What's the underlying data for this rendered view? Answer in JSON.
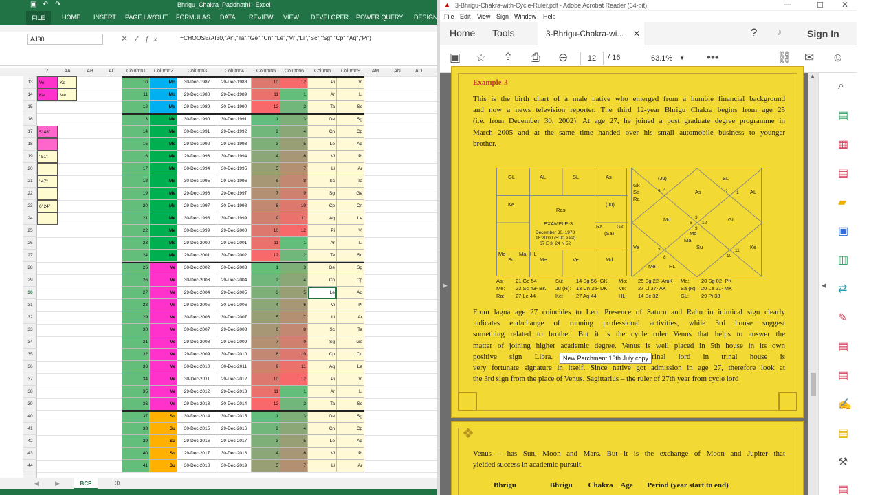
{
  "excel": {
    "title": "Bhrigu_Chakra_Paddhathi - Excel",
    "tabs": [
      "FILE",
      "HOME",
      "INSERT",
      "PAGE LAYOUT",
      "FORMULAS",
      "DATA",
      "REVIEW",
      "VIEW",
      "DEVELOPER",
      "POWER QUERY",
      "DESIGN"
    ],
    "name_box": "AJ30",
    "formula": "=CHOOSE(AI30,\"Ar\",\"Ta\",\"Ge\",\"Cn\",\"Le\",\"Vi\",\"Li\",\"Sc\",\"Sg\",\"Cp\",\"Aq\",\"Pi\")",
    "column_headers": [
      "Z",
      "AA",
      "AB",
      "AC",
      "Column1",
      "Column2",
      "Column3",
      "Column4",
      "Column5",
      "Column6",
      "Column",
      "Column9",
      "AM",
      "AN",
      "AO"
    ],
    "row_numbers": [
      "13",
      "14",
      "15",
      "16",
      "17",
      "18",
      "19",
      "20",
      "21",
      "22",
      "23",
      "24",
      "25",
      "26",
      "27",
      "28",
      "29",
      "30",
      "31",
      "32",
      "33",
      "34",
      "35",
      "36",
      "37",
      "38",
      "39",
      "40",
      "41",
      "42",
      "43",
      "44"
    ],
    "left_cells": [
      {
        "row": 0,
        "col": "z",
        "text": "Ve"
      },
      {
        "row": 0,
        "col": "aa",
        "text": "Ke"
      },
      {
        "row": 1,
        "col": "z",
        "text": "Ke"
      },
      {
        "row": 1,
        "col": "aa",
        "text": "Me"
      },
      {
        "row": 4,
        "col": "z",
        "text": "5' 48\""
      },
      {
        "row": 6,
        "col": "z",
        "text": "' 51\""
      },
      {
        "row": 8,
        "col": "z",
        "text": "' 47\""
      },
      {
        "row": 10,
        "col": "z",
        "text": "6' 24\""
      }
    ],
    "table_rows": [
      [
        "10",
        "Mo",
        "30-Dec-1987",
        "29-Dec-1988",
        "10",
        "12",
        "Pi",
        "Vi"
      ],
      [
        "11",
        "Mo",
        "29-Dec-1988",
        "29-Dec-1989",
        "11",
        "1",
        "Ar",
        "Li"
      ],
      [
        "12",
        "Mo",
        "29-Dec-1989",
        "30-Dec-1990",
        "12",
        "2",
        "Ta",
        "Sc"
      ],
      [
        "13",
        "Me",
        "30-Dec-1990",
        "30-Dec-1991",
        "1",
        "3",
        "Ge",
        "Sg"
      ],
      [
        "14",
        "Me",
        "30-Dec-1991",
        "29-Dec-1992",
        "2",
        "4",
        "Cn",
        "Cp"
      ],
      [
        "15",
        "Me",
        "29-Dec-1992",
        "29-Dec-1993",
        "3",
        "5",
        "Le",
        "Aq"
      ],
      [
        "16",
        "Me",
        "29-Dec-1993",
        "30-Dec-1994",
        "4",
        "6",
        "Vi",
        "Pi"
      ],
      [
        "17",
        "Me",
        "30-Dec-1994",
        "30-Dec-1995",
        "5",
        "7",
        "Li",
        "Ar"
      ],
      [
        "18",
        "Me",
        "30-Dec-1995",
        "29-Dec-1996",
        "6",
        "8",
        "Sc",
        "Ta"
      ],
      [
        "19",
        "Me",
        "29-Dec-1996",
        "29-Dec-1997",
        "7",
        "9",
        "Sg",
        "Ge"
      ],
      [
        "20",
        "Me",
        "29-Dec-1997",
        "30-Dec-1998",
        "8",
        "10",
        "Cp",
        "Cn"
      ],
      [
        "21",
        "Me",
        "30-Dec-1998",
        "30-Dec-1999",
        "9",
        "11",
        "Aq",
        "Le"
      ],
      [
        "22",
        "Me",
        "30-Dec-1999",
        "29-Dec-2000",
        "10",
        "12",
        "Pi",
        "Vi"
      ],
      [
        "23",
        "Me",
        "29-Dec-2000",
        "29-Dec-2001",
        "11",
        "1",
        "Ar",
        "Li"
      ],
      [
        "24",
        "Me",
        "29-Dec-2001",
        "30-Dec-2002",
        "12",
        "2",
        "Ta",
        "Sc"
      ],
      [
        "25",
        "Ve",
        "30-Dec-2002",
        "30-Dec-2003",
        "1",
        "3",
        "Ge",
        "Sg"
      ],
      [
        "26",
        "Ve",
        "30-Dec-2003",
        "29-Dec-2004",
        "2",
        "4",
        "Cn",
        "Cp"
      ],
      [
        "27",
        "Ve",
        "29-Dec-2004",
        "29-Dec-2005",
        "3",
        "5",
        "Le",
        "Aq"
      ],
      [
        "28",
        "Ve",
        "29-Dec-2005",
        "30-Dec-2006",
        "4",
        "6",
        "Vi",
        "Pi"
      ],
      [
        "29",
        "Ve",
        "30-Dec-2006",
        "30-Dec-2007",
        "5",
        "7",
        "Li",
        "Ar"
      ],
      [
        "30",
        "Ve",
        "30-Dec-2007",
        "29-Dec-2008",
        "6",
        "8",
        "Sc",
        "Ta"
      ],
      [
        "31",
        "Ve",
        "29-Dec-2008",
        "29-Dec-2009",
        "7",
        "9",
        "Sg",
        "Ge"
      ],
      [
        "32",
        "Ve",
        "29-Dec-2009",
        "30-Dec-2010",
        "8",
        "10",
        "Cp",
        "Cn"
      ],
      [
        "33",
        "Ve",
        "30-Dec-2010",
        "30-Dec-2011",
        "9",
        "11",
        "Aq",
        "Le"
      ],
      [
        "34",
        "Ve",
        "30-Dec-2011",
        "29-Dec-2012",
        "10",
        "12",
        "Pi",
        "Vi"
      ],
      [
        "35",
        "Ve",
        "29-Dec-2012",
        "29-Dec-2013",
        "11",
        "1",
        "Ar",
        "Li"
      ],
      [
        "36",
        "Ve",
        "29-Dec-2013",
        "30-Dec-2014",
        "12",
        "2",
        "Ta",
        "Sc"
      ],
      [
        "37",
        "Su",
        "30-Dec-2014",
        "30-Dec-2015",
        "1",
        "3",
        "Ge",
        "Sg"
      ],
      [
        "38",
        "Su",
        "30-Dec-2015",
        "29-Dec-2016",
        "2",
        "4",
        "Cn",
        "Cp"
      ],
      [
        "39",
        "Su",
        "29-Dec-2016",
        "29-Dec-2017",
        "3",
        "5",
        "Le",
        "Aq"
      ],
      [
        "40",
        "Su",
        "29-Dec-2017",
        "30-Dec-2018",
        "4",
        "6",
        "Vi",
        "Pi"
      ],
      [
        "41",
        "Su",
        "30-Dec-2018",
        "30-Dec-2019",
        "5",
        "7",
        "Li",
        "Ar"
      ]
    ],
    "sheet_tab": "BCP",
    "colors": {
      "green": "#217346",
      "moon": "#00b0f0",
      "mercury": "#00b050",
      "venus": "#ff33cc",
      "sun": "#ffb000",
      "cell_green": "#63be7b"
    }
  },
  "acrobat": {
    "title": "3-Bhrigu-Chakra-with-Cycle-Ruler.pdf - Adobe Acrobat Reader (64-bit)",
    "menu": [
      "File",
      "Edit",
      "View",
      "Sign",
      "Window",
      "Help"
    ],
    "nav": {
      "home": "Home",
      "tools": "Tools",
      "doc_tab": "3-Bhrigu-Chakra-wi...",
      "sign_in": "Sign In"
    },
    "page_current": "12",
    "page_total": "/ 16",
    "zoom": "63.1%",
    "heading": "Example-3",
    "para1_lines": [
      "This is the birth chart of a male native who emerged from a humble financial background",
      "and now a news television reporter. The third 12-year Bhrigu Chakra begins from age 25",
      "(i.e. from December 30, 2002). At age 27, he joined a post graduate degree programme in",
      "March 2005 and at the same time handed over his small automobile business to younger",
      "brother."
    ],
    "rasi": {
      "cells": [
        "GL",
        "AL",
        "SL",
        "As",
        "Ke",
        "(Ju)",
        "Ra",
        "Gk",
        "(Sa)",
        "Mo",
        "Ma",
        "HL",
        "Su",
        "Me",
        "Ve",
        "Md"
      ],
      "center": [
        "Rasi",
        "EXAMPLE-3",
        "December 30, 1978",
        "18:20:00 (5:00 east)",
        "67 E 3, 24 N 52"
      ]
    },
    "navamsa": {
      "labels": [
        "(Ju)",
        "SL",
        "Gk",
        "Sa",
        "Ra",
        "As",
        "AL",
        "Md",
        "GL",
        "Mo",
        "Ma",
        "Su",
        "Ve",
        "Ke",
        "Me",
        "HL"
      ],
      "numbers": [
        "5",
        "4",
        "2",
        "1",
        "3",
        "6",
        "12",
        "9",
        "7",
        "8",
        "11",
        "10"
      ]
    },
    "positions": [
      [
        "As:",
        "21 Ge 54",
        "Su:",
        "14 Sg 56- GK",
        "Mo:",
        "25 Sg 22- AmK",
        "Ma:",
        "20 Sg 02- PK"
      ],
      [
        "Me:",
        "23 Sc 43- BK",
        "Ju (R):",
        "13 Cn 35- DK",
        "Ve:",
        "27 Li 37- AK",
        "Sa (R):",
        "20 Le 21- MK"
      ],
      [
        "Ra:",
        "27 Le 44",
        "Ke:",
        "27 Aq 44",
        "HL:",
        "14 Sc 32",
        "GL:",
        "29 Pi 38"
      ]
    ],
    "para2_lines": [
      "From lagna age 27 coincides to Leo. Presence of Saturn and Rahu in inimical sign clearly",
      "indicates end/change of running professional activities, while 3rd house suggest",
      "something related to brother. But it is the cycle ruler Venus that helps to answer the",
      "matter of joining higher academic degree. Venus is well placed in 5th house in its own",
      "positive sign Libra. Although... but a trinal lord in trinal house is",
      "very fortunate signature in itself. Since native got admission in age 27, therefore look at",
      "the 3rd sign from the place of Venus. Sagittarius – the ruler of 27th year from cycle lord"
    ],
    "tooltip": "New Parchment 13th July copy",
    "para3_lines": [
      "Venus – has Sun, Moon and Mars. But it is the exchange of Moon and Jupiter that",
      "yielded success in academic pursuit."
    ],
    "table_header": [
      "Bhrigu",
      "Bhrigu",
      "Chakra",
      "Age",
      "Period (year start to end)"
    ],
    "page_bg": "#f3d934"
  }
}
